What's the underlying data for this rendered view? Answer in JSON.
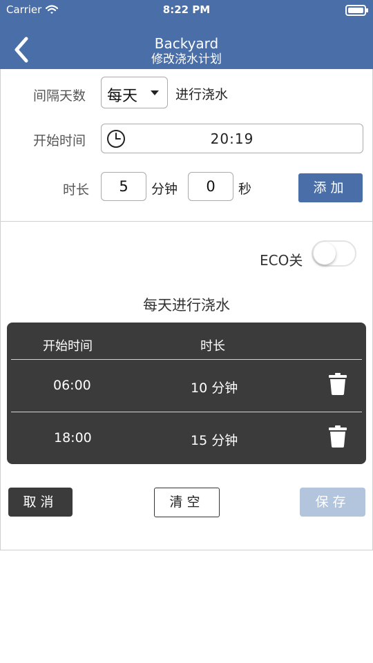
{
  "status_bar": {
    "carrier": "Carrier",
    "time": "8:22 PM"
  },
  "header": {
    "title": "Backyard",
    "subtitle": "修改浇水计划"
  },
  "form": {
    "interval_label": "间隔天数",
    "interval_value": "每天",
    "interval_suffix": "进行浇水",
    "start_label": "开始时间",
    "start_value": "20:19",
    "duration_label": "时长",
    "minutes_value": "5",
    "minutes_unit": "分钟",
    "seconds_value": "0",
    "seconds_unit": "秒",
    "add_button": "添加"
  },
  "schedule": {
    "eco_label": "ECO关",
    "eco_on": false,
    "plan_title": "每天进行浇水",
    "columns": [
      "开始时间",
      "时长"
    ],
    "rows": [
      {
        "start": "06:00",
        "duration": "10 分钟"
      },
      {
        "start": "18:00",
        "duration": "15 分钟"
      }
    ]
  },
  "actions": {
    "cancel": "取消",
    "clear": "清空",
    "save": "保存"
  },
  "colors": {
    "header_bg": "#4a6fa8",
    "table_bg": "#3b3b3b",
    "save_disabled": "#b3c4dd"
  }
}
